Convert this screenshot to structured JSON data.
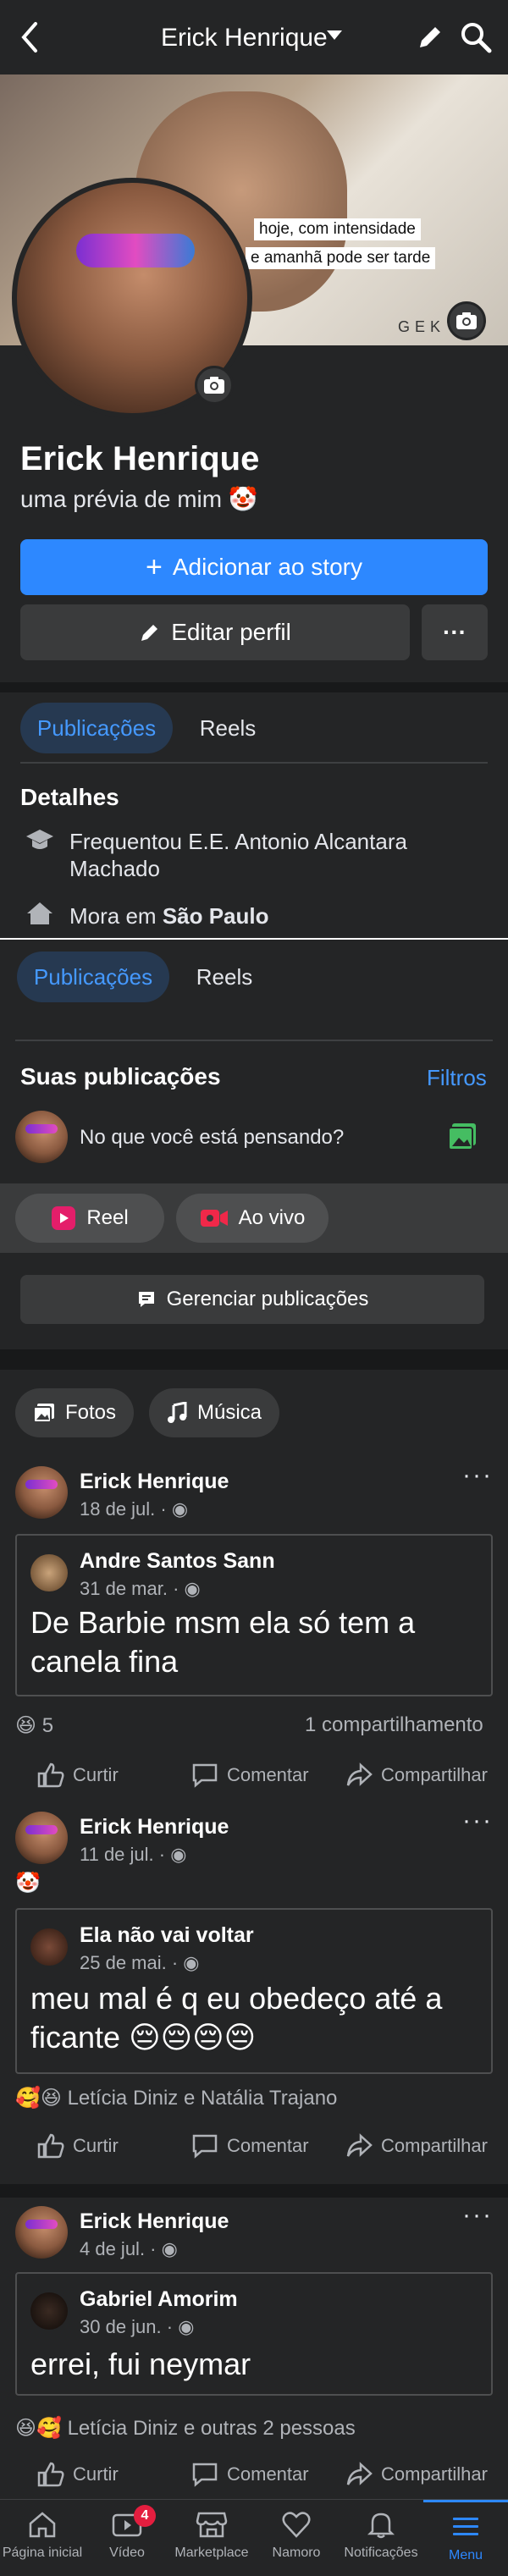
{
  "header": {
    "back_icon": "chevron-left-icon",
    "title": "Erick Henrique",
    "edit_icon": "pencil-icon",
    "search_icon": "search-icon"
  },
  "cover": {
    "caption_line1": "hoje, com intensidade",
    "caption_line2": "e amanhã pode ser tarde",
    "watermark": "GEK"
  },
  "profile": {
    "name": "Erick Henrique",
    "bio": "uma prévia de mim 🤡",
    "add_story": "Adicionar ao story",
    "edit_profile": "Editar perfil",
    "more": "···"
  },
  "tabs_top": {
    "publications": "Publicações",
    "reels": "Reels"
  },
  "details": {
    "title": "Detalhes",
    "studied": "Frequentou E.E. Antonio Alcantara Machado",
    "lives_prefix": "Mora em ",
    "lives_city": "São Paulo"
  },
  "tabs_second": {
    "publications": "Publicações",
    "reels": "Reels"
  },
  "your_posts": {
    "title": "Suas publicações",
    "filters": "Filtros",
    "composer_placeholder": "No que você está pensando?"
  },
  "create": {
    "reel": "Reel",
    "live": "Ao vivo",
    "manage": "Gerenciar publicações"
  },
  "media_chips": {
    "photos": "Fotos",
    "music": "Música"
  },
  "posts": [
    {
      "author": "Erick Henrique",
      "date": "18 de jul. ·",
      "caption": "",
      "shared_author": "Andre Santos Sann",
      "shared_date": "31 de mar. ·",
      "shared_text": "De Barbie msm ela só tem a canela fina",
      "reactions": "😆 5",
      "shares": "1 compartilhamento"
    },
    {
      "author": "Erick Henrique",
      "date": "11 de jul. ·",
      "caption": "🤡",
      "shared_author": "Ela não vai voltar",
      "shared_date": "25 de mai. ·",
      "shared_text": "meu mal é q eu obedeço até a ficante 😔😔😔😔",
      "reactions": "🥰😆 Letícia Diniz e Natália Trajano",
      "shares": ""
    },
    {
      "author": "Erick Henrique",
      "date": "4 de jul. ·",
      "caption": "",
      "shared_author": "Gabriel Amorim",
      "shared_date": "30 de jun. ·",
      "shared_text": "errei, fui neymar",
      "reactions": "😆🥰 Letícia Diniz e outras 2 pessoas",
      "shares": ""
    }
  ],
  "actions": {
    "like": "Curtir",
    "comment": "Comentar",
    "share": "Compartilhar"
  },
  "nav": {
    "home": "Página inicial",
    "video": "Vídeo",
    "video_badge": "4",
    "marketplace": "Marketplace",
    "dating": "Namoro",
    "notifications": "Notificações",
    "menu": "Menu"
  },
  "colors": {
    "background": "#242526",
    "accent": "#2d88ff",
    "separator": "#18191a",
    "badge": "#e41e3f"
  }
}
